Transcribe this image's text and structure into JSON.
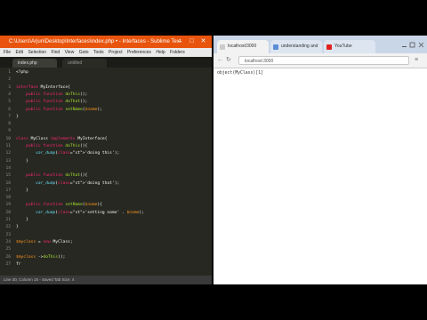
{
  "sublime": {
    "title": "C:\\Users\\Arjun\\Desktop\\Interfaces\\index.php • - Interfaces - Sublime Text",
    "menu": [
      "File",
      "Edit",
      "Selection",
      "Find",
      "View",
      "Goto",
      "Tools",
      "Project",
      "Preferences",
      "Help",
      "Folders"
    ],
    "tabs": [
      "index.php",
      "untitled"
    ],
    "status": "Line 30, Column 15 - Saved   Tab Size: 4"
  },
  "code_lines": [
    {
      "n": "1",
      "t": "<?php"
    },
    {
      "n": "2",
      "t": ""
    },
    {
      "n": "3",
      "t": "interface MyInterface{"
    },
    {
      "n": "4",
      "t": "    public function doThis();"
    },
    {
      "n": "5",
      "t": "    public function doThat();"
    },
    {
      "n": "6",
      "t": "    public function setName($name);"
    },
    {
      "n": "7",
      "t": "}"
    },
    {
      "n": "8",
      "t": ""
    },
    {
      "n": "9",
      "t": ""
    },
    {
      "n": "10",
      "t": "class MyClass implements MyInterface{"
    },
    {
      "n": "11",
      "t": "    public function doThis(){"
    },
    {
      "n": "12",
      "t": "        var_dump('doing this');"
    },
    {
      "n": "13",
      "t": "    }"
    },
    {
      "n": "14",
      "t": ""
    },
    {
      "n": "15",
      "t": "    public function doThat(){"
    },
    {
      "n": "16",
      "t": "        var_dump('doing that');"
    },
    {
      "n": "17",
      "t": "    }"
    },
    {
      "n": "18",
      "t": ""
    },
    {
      "n": "19",
      "t": "    public function setName($name){"
    },
    {
      "n": "20",
      "t": "        var_dump('setting name' . $name);"
    },
    {
      "n": "21",
      "t": "    }"
    },
    {
      "n": "22",
      "t": "}"
    },
    {
      "n": "23",
      "t": ""
    },
    {
      "n": "24",
      "t": "$myclass = new MyClass;"
    },
    {
      "n": "25",
      "t": ""
    },
    {
      "n": "26",
      "t": "$myclass ->doThis();"
    },
    {
      "n": "27",
      "t": "fr"
    }
  ],
  "chrome": {
    "tabs": [
      "localhost/3000",
      "understanding and im...",
      "YouTube"
    ],
    "url": "localhost:3000",
    "output": "object(MyClass)[1]"
  },
  "colors": {
    "title_bar": "#e8540d",
    "editor_bg": "#272822",
    "keyword": "#f92672",
    "function": "#a6e22e",
    "string": "#e6db74"
  }
}
